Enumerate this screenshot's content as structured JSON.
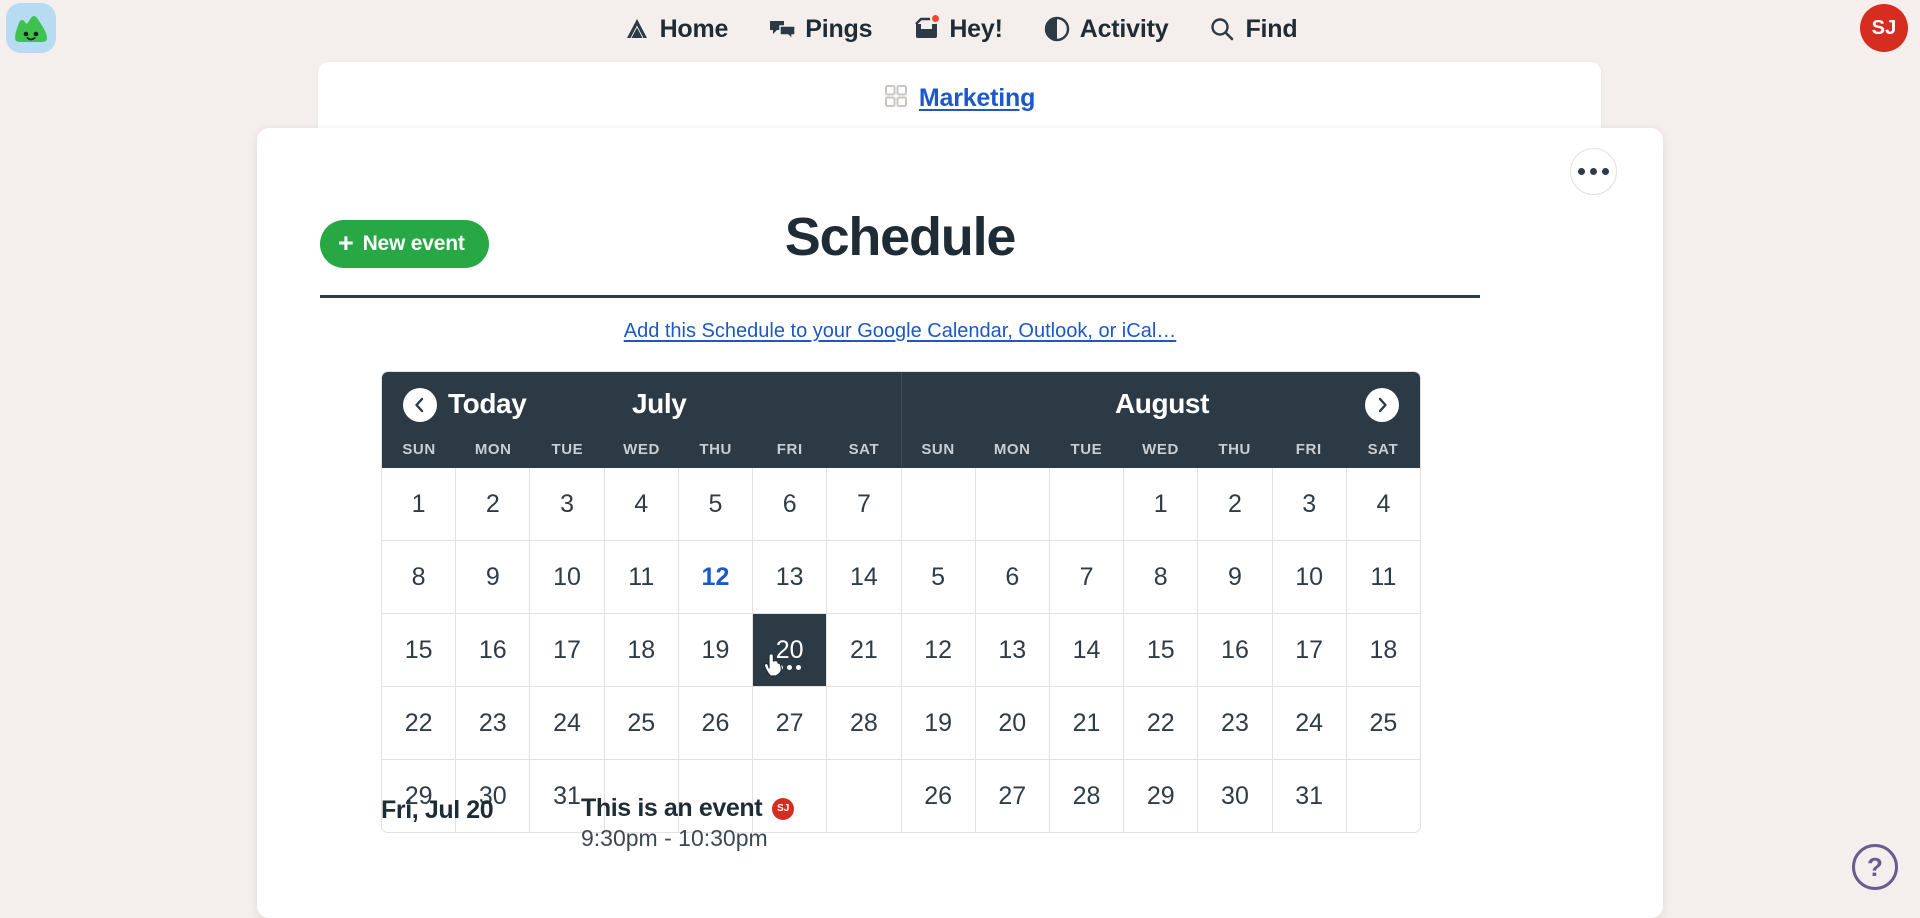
{
  "nav": {
    "logo_name": "basecamp-logo",
    "items": [
      {
        "label": "Home",
        "icon": "home-icon",
        "badge": false
      },
      {
        "label": "Pings",
        "icon": "pings-icon",
        "badge": false
      },
      {
        "label": "Hey!",
        "icon": "hey-inbox-icon",
        "badge": true
      },
      {
        "label": "Activity",
        "icon": "activity-icon",
        "badge": false
      },
      {
        "label": "Find",
        "icon": "search-icon",
        "badge": false
      }
    ],
    "avatar_initials": "SJ",
    "avatar_color": "#d62d20"
  },
  "breadcrumb": {
    "icon": "grid-squares-icon",
    "label": "Marketing",
    "link_color": "#1b58c9"
  },
  "card": {
    "more_menu_label": "•••",
    "new_event_label": "New event",
    "new_event_color": "#28a745",
    "title": "Schedule",
    "ical_link": "Add this Schedule to your Google Calendar, Outlook, or iCal…"
  },
  "calendar": {
    "today_label": "Today",
    "prev_label": "‹",
    "next_label": "›",
    "months": [
      {
        "name": "July",
        "first_weekday": 0,
        "days": 31
      },
      {
        "name": "August",
        "first_weekday": 3,
        "days": 31
      }
    ],
    "weekdays": [
      "SUN",
      "MON",
      "TUE",
      "WED",
      "THU",
      "FRI",
      "SAT"
    ],
    "today_date": {
      "month": "July",
      "day": 12
    },
    "selected_date": {
      "month": "July",
      "day": 20,
      "event_dots": 3
    },
    "header_bg": "#2b3a45",
    "today_color": "#1b58c9"
  },
  "events": [
    {
      "date": "Fri, Jul 20",
      "title": "This is an event",
      "time": "9:30pm - 10:30pm",
      "avatar_initials": "SJ",
      "avatar_color": "#d62d20"
    }
  ],
  "help": {
    "label": "?",
    "color": "#6b5b8f"
  }
}
